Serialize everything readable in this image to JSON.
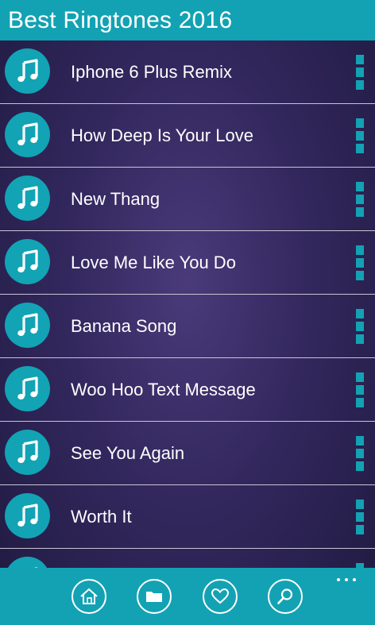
{
  "header": {
    "title": "Best Ringtones 2016"
  },
  "colors": {
    "accent": "#13a2b3",
    "background": "#33285e",
    "text": "#ffffff"
  },
  "list": {
    "item_icon": "music-note-icon",
    "more_icon": "more-vertical-icon",
    "items": [
      {
        "title": "Iphone 6 Plus Remix"
      },
      {
        "title": "How Deep Is Your Love"
      },
      {
        "title": "New Thang"
      },
      {
        "title": "Love Me Like You Do"
      },
      {
        "title": "Banana Song"
      },
      {
        "title": "Woo Hoo Text Message"
      },
      {
        "title": "See You Again"
      },
      {
        "title": "Worth It"
      },
      {
        "title": ""
      }
    ]
  },
  "bottom_bar": {
    "buttons": [
      {
        "icon": "home-icon"
      },
      {
        "icon": "folder-icon"
      },
      {
        "icon": "heart-icon"
      },
      {
        "icon": "search-icon"
      }
    ],
    "more_icon": "ellipsis-icon"
  }
}
